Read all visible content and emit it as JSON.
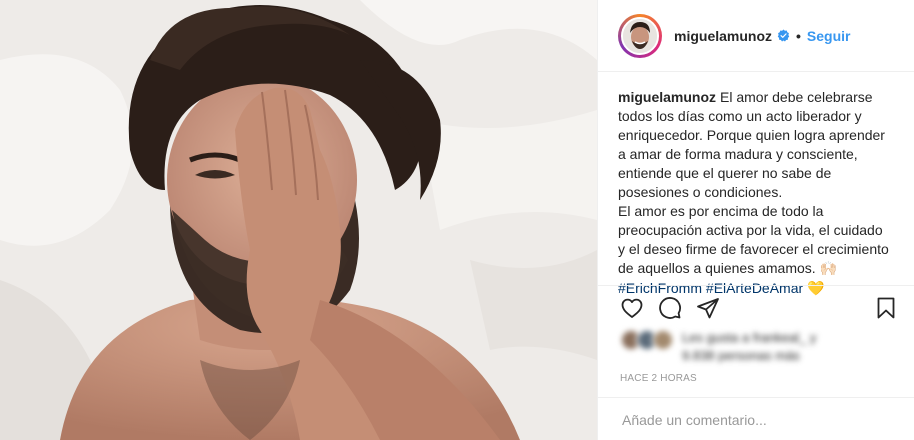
{
  "post": {
    "username": "miguelamunoz",
    "dot": "•",
    "follow_label": "Seguir",
    "caption": {
      "username": "miguelamunoz",
      "lines": [
        "El amor debe celebrarse",
        "todos los días como un acto liberador y",
        "enriquecedor. Porque quien logra aprender",
        "a amar de forma madura y consciente,",
        "entiende que el querer no sabe de",
        "posesiones o condiciones.",
        "El amor es por encima de todo la",
        "preocupación activa por la vida, el cuidado",
        "y el deseo firme de favorecer el crecimiento",
        "de aquellos a quienes amamos."
      ],
      "raised_hands_emoji": "🙌🏻",
      "hashtags": [
        "#ErichFromm",
        "#ElArteDeAmar"
      ],
      "heart_emoji": "💛"
    },
    "likes_line1": "Les gusta a  frankeal_ y",
    "likes_line2": "9.838 personas más",
    "time_ago": "HACE 2 HORAS",
    "comment_placeholder": "Añade un comentario..."
  },
  "icons": {
    "verified": "verified-badge-icon",
    "like": "heart-outline-icon",
    "comment": "speech-bubble-icon",
    "share": "paper-plane-icon",
    "save": "bookmark-icon"
  },
  "colors": {
    "link_blue": "#3897f0",
    "hashtag": "#003569",
    "text": "#262626",
    "muted": "#999999",
    "divider": "#efefef"
  }
}
